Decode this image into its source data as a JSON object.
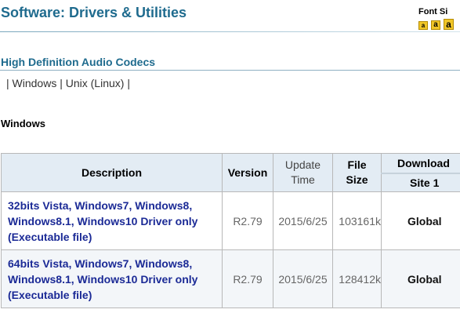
{
  "page": {
    "title": "Software: Drivers & Utilities",
    "font_size_label": "Font Si",
    "font_buttons": [
      "a",
      "a",
      "a"
    ]
  },
  "section": {
    "title": "High Definition Audio Codecs"
  },
  "os_nav": {
    "separator": "|",
    "items": [
      "Windows",
      "Unix (Linux)"
    ]
  },
  "group_heading": "Windows",
  "table": {
    "headers": {
      "description": "Description",
      "version": "Version",
      "update_time_line1": "Update",
      "update_time_line2": "Time",
      "file_size_line1": "File",
      "file_size_line2": "Size",
      "download": "Download",
      "site1": "Site 1"
    },
    "rows": [
      {
        "description_line1": "32bits Vista, Windows7, Windows8,",
        "description_line2": "Windows8.1, Windows10 Driver only",
        "description_line3": "(Executable file)",
        "version": "R2.79",
        "update_time": "2015/6/25",
        "file_size": "103161k",
        "download": "Global"
      },
      {
        "description_line1": "64bits Vista, Windows7, Windows8,",
        "description_line2": "Windows8.1, Windows10 Driver only",
        "description_line3": "(Executable file)",
        "version": "R2.79",
        "update_time": "2015/6/25",
        "file_size": "128412k",
        "download": "Global"
      }
    ]
  },
  "colors": {
    "title": "#1f6b8e",
    "link": "#1b2a96",
    "header_bg": "#e3ecf4",
    "font_button": "#f1c628"
  }
}
